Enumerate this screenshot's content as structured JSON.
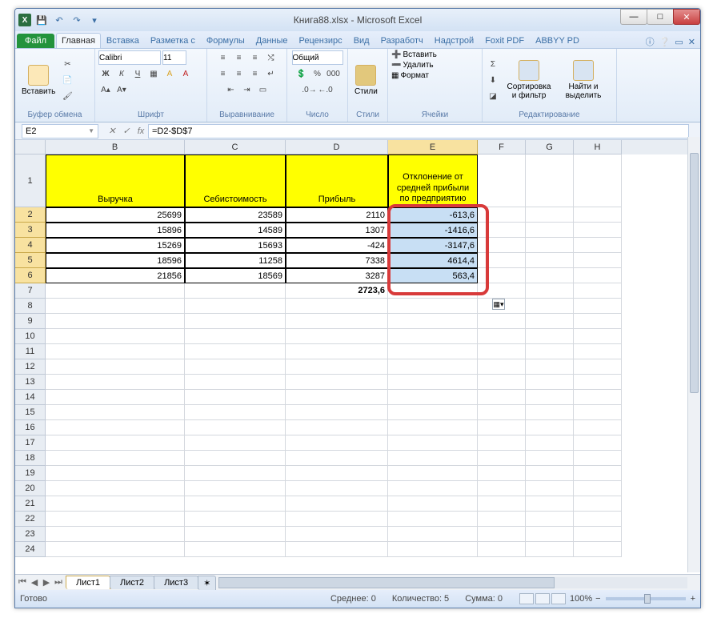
{
  "title": "Книга88.xlsx - Microsoft Excel",
  "tabs": {
    "file": "Файл",
    "home": "Главная",
    "insert": "Вставка",
    "layout": "Разметка с",
    "formulas": "Формулы",
    "data": "Данные",
    "review": "Рецензирс",
    "view": "Вид",
    "developer": "Разработч",
    "addins": "Надстрой",
    "foxit": "Foxit PDF",
    "abbyy": "ABBYY PD"
  },
  "ribbon": {
    "paste": "Вставить",
    "clipboard": "Буфер обмена",
    "font_name": "Calibri",
    "font_size": "11",
    "font": "Шрифт",
    "alignment": "Выравнивание",
    "numfmt": "Общий",
    "number": "Число",
    "styles": "Стили",
    "styles_btn": "Стили",
    "insert_btn": "Вставить",
    "delete_btn": "Удалить",
    "format_btn": "Формат",
    "cells": "Ячейки",
    "sort": "Сортировка и фильтр",
    "find": "Найти и выделить",
    "editing": "Редактирование"
  },
  "namebox": "E2",
  "formula": "=D2-$D$7",
  "columns": [
    "B",
    "C",
    "D",
    "E",
    "F",
    "G",
    "H"
  ],
  "col_widths": [
    "wB",
    "wC",
    "wD",
    "wE",
    "wR",
    "wR",
    "wR"
  ],
  "headers": {
    "B": "Выручка",
    "C": "Себистоимость",
    "D": "Прибыль",
    "E": "Отклонение от средней прибыли по предприятию"
  },
  "rows": [
    {
      "B": "25699",
      "C": "23589",
      "D": "2110",
      "E": "-613,6"
    },
    {
      "B": "15896",
      "C": "14589",
      "D": "1307",
      "E": "-1416,6"
    },
    {
      "B": "15269",
      "C": "15693",
      "D": "-424",
      "E": "-3147,6"
    },
    {
      "B": "18596",
      "C": "11258",
      "D": "7338",
      "E": "4614,4"
    },
    {
      "B": "21856",
      "C": "18569",
      "D": "3287",
      "E": "563,4"
    }
  ],
  "avg_d": "2723,6",
  "sheets": {
    "s1": "Лист1",
    "s2": "Лист2",
    "s3": "Лист3"
  },
  "status": {
    "ready": "Готово",
    "avg": "Среднее: 0",
    "count": "Количество: 5",
    "sum": "Сумма: 0",
    "zoom": "100%"
  }
}
